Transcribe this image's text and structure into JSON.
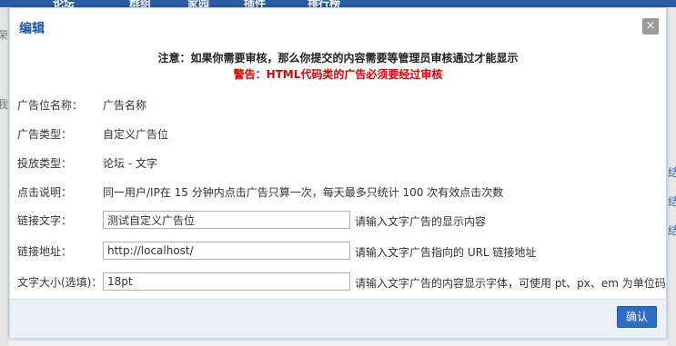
{
  "background": {
    "nav_items": [
      "论坛",
      "群组",
      "家园",
      "插件",
      "排行榜"
    ],
    "left_fragments": [
      "荣",
      "我"
    ],
    "right_fragments": [
      "结",
      "结",
      "结"
    ]
  },
  "dialog": {
    "title": "编辑",
    "close_label": "×",
    "notice": "注意：如果你需要审核，那么你提交的内容需要等管理员审核通过才能显示",
    "warning": "警告：HTML代码类的广告必须要经过审核",
    "fields": [
      {
        "label": "广告位名称：",
        "value": "广告名称"
      },
      {
        "label": "广告类型：",
        "value": "自定义广告位"
      },
      {
        "label": "投放类型：",
        "value": "论坛 - 文字"
      },
      {
        "label": "点击说明：",
        "value": "同一用户/IP在 15 分钟内点击广告只算一次，每天最多只统计 100 次有效点击次数"
      }
    ],
    "inputs": [
      {
        "label": "链接文字：",
        "value": "测试自定义广告位",
        "hint": "请输入文字广告的显示内容"
      },
      {
        "label": "链接地址：",
        "value": "http://localhost/",
        "hint": "请输入文字广告指向的 URL 链接地址"
      },
      {
        "label": "文字大小(选填)：",
        "value": "18pt",
        "hint": "请输入文字广告的内容显示字体，可使用 pt、px、em 为单位码"
      }
    ],
    "confirm_label": "确认"
  },
  "colors": {
    "title_blue": "#1d54a8",
    "warning_red": "#e00000",
    "button_blue": "#2f6dc4",
    "nav_blue": "#2a5ca6"
  }
}
